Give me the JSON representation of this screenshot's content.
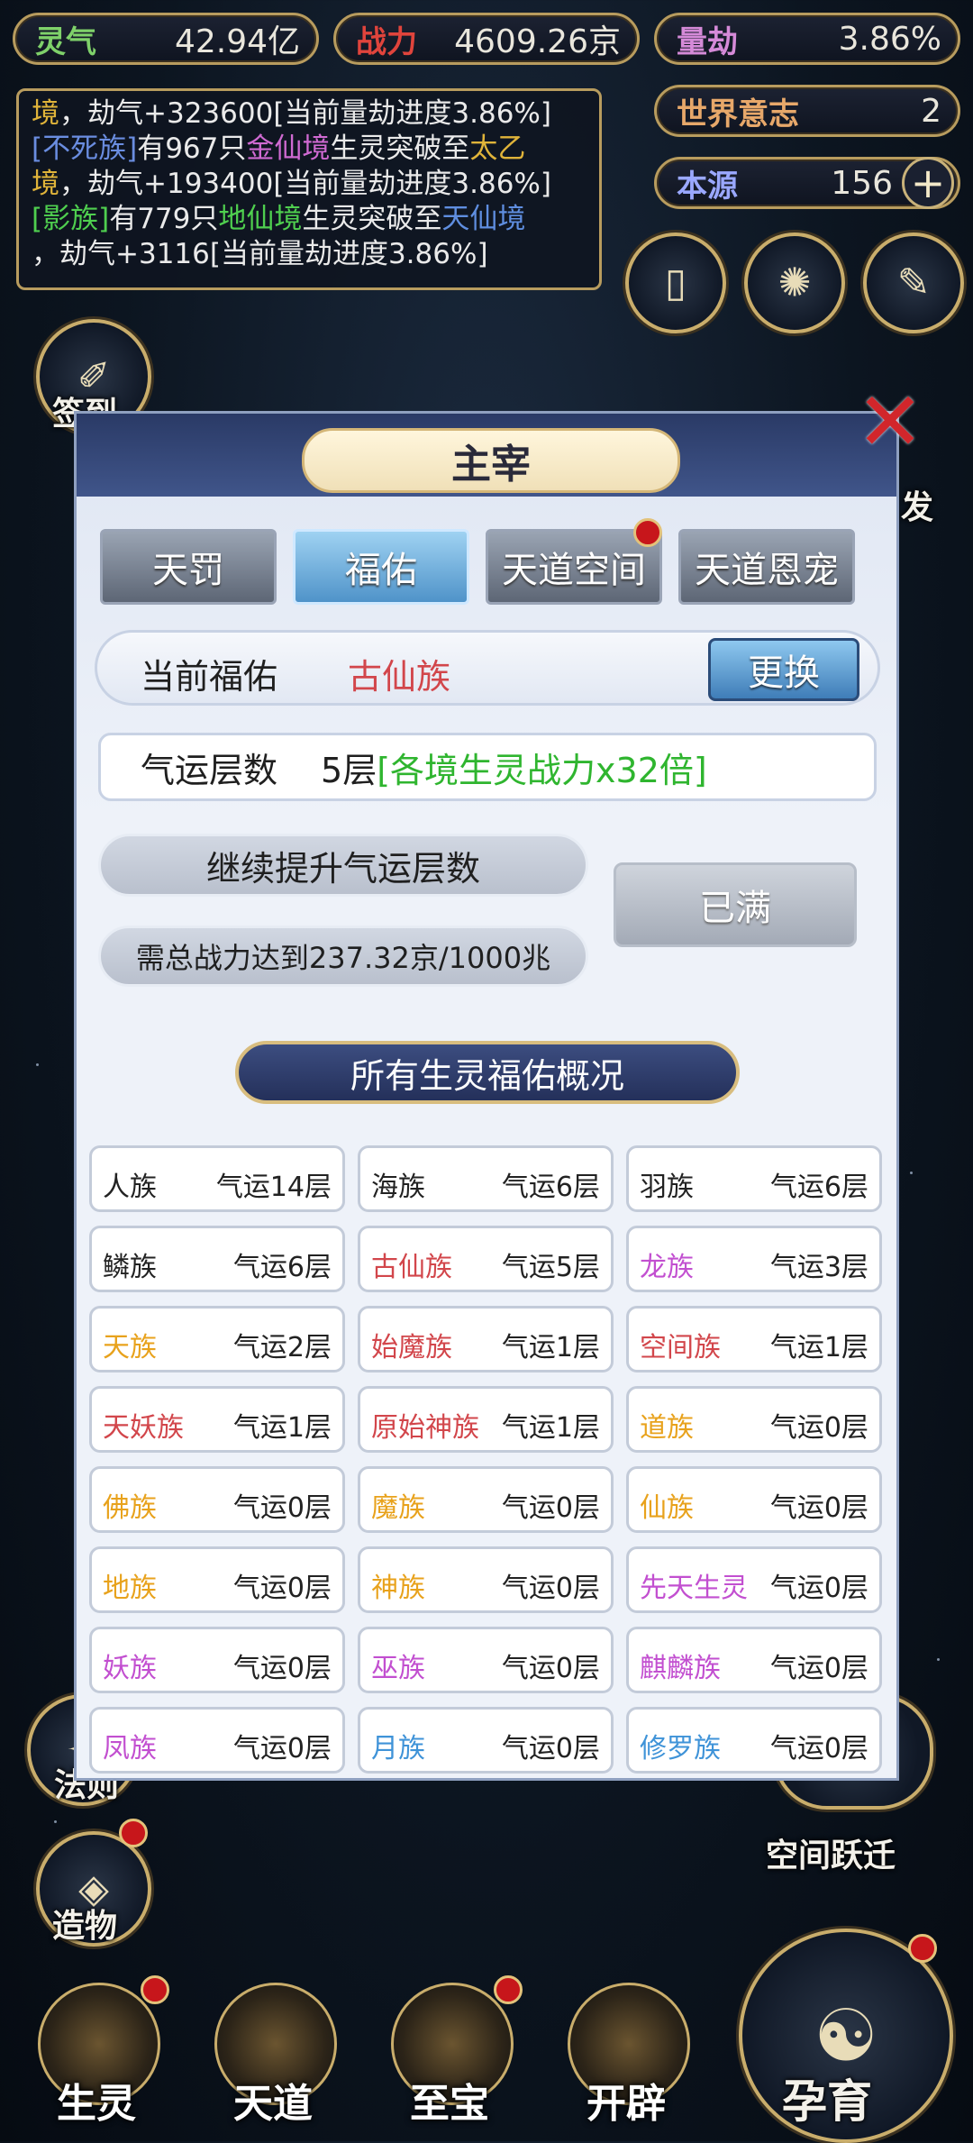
{
  "resources": {
    "lingqi": {
      "label": "灵气",
      "value": "42.94亿",
      "color": "#7fd16a"
    },
    "zhanli": {
      "label": "战力",
      "value": "4609.26京",
      "color": "#e0443c"
    },
    "liangjie": {
      "label": "量劫",
      "value": "3.86%",
      "color": "#d58ad8"
    },
    "world_will": {
      "label": "世界意志",
      "value": "2",
      "color": "#e7a86a"
    },
    "benyuan": {
      "label": "本源",
      "value": "156",
      "color": "#9aa8ff",
      "plus": "+"
    }
  },
  "log": [
    [
      {
        "t": "境",
        "c": "#e0b43a"
      },
      {
        "t": "，劫气+323600[当前量劫进度3.86%]",
        "c": "#eaeaea"
      }
    ],
    [
      {
        "t": "[不死族]",
        "c": "#6a8de0"
      },
      {
        "t": "有967只",
        "c": "#eaeaea"
      },
      {
        "t": "金仙境",
        "c": "#d06ad2"
      },
      {
        "t": "生灵突破至",
        "c": "#eaeaea"
      },
      {
        "t": "太乙",
        "c": "#e0b43a"
      }
    ],
    [
      {
        "t": "境",
        "c": "#e0b43a"
      },
      {
        "t": "，劫气+193400[当前量劫进度3.86%]",
        "c": "#eaeaea"
      }
    ],
    [
      {
        "t": "[影族]",
        "c": "#4fcf4f"
      },
      {
        "t": "有779只",
        "c": "#eaeaea"
      },
      {
        "t": "地仙境",
        "c": "#4fcf4f"
      },
      {
        "t": "生灵突破至",
        "c": "#eaeaea"
      },
      {
        "t": "天仙境",
        "c": "#5f8ee0"
      }
    ],
    [
      {
        "t": "，劫气+3116[当前量劫进度3.86%]",
        "c": "#eaeaea"
      }
    ]
  ],
  "side_labels": {
    "qiandao": "签到",
    "fa": "发",
    "fazheng": "法则",
    "kongjian": "空间跃迁",
    "zaowu": "造物"
  },
  "bottom_nav": [
    "生灵",
    "天道",
    "至宝",
    "开辟"
  ],
  "yunyu": "孕育",
  "modal": {
    "title": "主宰",
    "tabs": [
      "天罚",
      "福佑",
      "天道空间",
      "天道恩宠"
    ],
    "active_tab": 1,
    "current_blessing_label": "当前福佑",
    "current_blessing_value": "古仙族",
    "swap_button": "更换",
    "fortune_label": "气运层数",
    "fortune_level": "5层",
    "fortune_bonus": "[各境生灵战力x32倍]",
    "continue_label": "继续提升气运层数",
    "requirement": "需总战力达到237.32京/1000兆",
    "full_button": "已满",
    "overview_title": "所有生灵福佑概况",
    "races": [
      {
        "name": "人族",
        "level": "气运14层",
        "color": "#222222"
      },
      {
        "name": "海族",
        "level": "气运6层",
        "color": "#222222"
      },
      {
        "name": "羽族",
        "level": "气运6层",
        "color": "#222222"
      },
      {
        "name": "鳞族",
        "level": "气运6层",
        "color": "#222222"
      },
      {
        "name": "古仙族",
        "level": "气运5层",
        "color": "#d2464b"
      },
      {
        "name": "龙族",
        "level": "气运3层",
        "color": "#c24fd0"
      },
      {
        "name": "天族",
        "level": "气运2层",
        "color": "#e8a21c"
      },
      {
        "name": "始魔族",
        "level": "气运1层",
        "color": "#d2464b"
      },
      {
        "name": "空间族",
        "level": "气运1层",
        "color": "#d2464b"
      },
      {
        "name": "天妖族",
        "level": "气运1层",
        "color": "#d2464b"
      },
      {
        "name": "原始神族",
        "level": "气运1层",
        "color": "#d2464b"
      },
      {
        "name": "道族",
        "level": "气运0层",
        "color": "#e8a21c"
      },
      {
        "name": "佛族",
        "level": "气运0层",
        "color": "#e8a21c"
      },
      {
        "name": "魔族",
        "level": "气运0层",
        "color": "#e8a21c"
      },
      {
        "name": "仙族",
        "level": "气运0层",
        "color": "#e8a21c"
      },
      {
        "name": "地族",
        "level": "气运0层",
        "color": "#e8a21c"
      },
      {
        "name": "神族",
        "level": "气运0层",
        "color": "#e8a21c"
      },
      {
        "name": "先天生灵",
        "level": "气运0层",
        "color": "#c24fd0"
      },
      {
        "name": "妖族",
        "level": "气运0层",
        "color": "#c24fd0"
      },
      {
        "name": "巫族",
        "level": "气运0层",
        "color": "#c24fd0"
      },
      {
        "name": "麒麟族",
        "level": "气运0层",
        "color": "#c24fd0"
      },
      {
        "name": "凤族",
        "level": "气运0层",
        "color": "#c24fd0"
      },
      {
        "name": "月族",
        "level": "气运0层",
        "color": "#3f93d8"
      },
      {
        "name": "修罗族",
        "level": "气运0层",
        "color": "#3f93d8"
      }
    ]
  }
}
